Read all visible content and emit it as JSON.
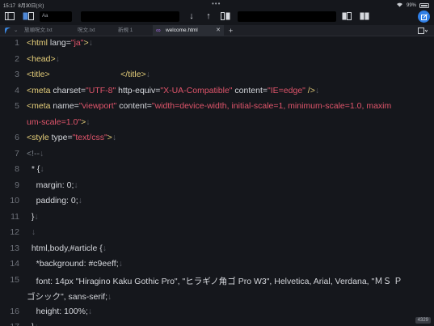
{
  "status": {
    "time": "15:17",
    "date": "8月30日(火)",
    "battery_percent": "99%"
  },
  "toolbar": {
    "box1_label": "Aa",
    "box2_label": "",
    "box3_label": "",
    "icons": [
      "sidebar-icon",
      "split-icon",
      "undo-icon",
      "redo-icon",
      "arrow-down-icon",
      "arrow-up-icon",
      "replace-icon",
      "compose-icon"
    ]
  },
  "tabs": [
    {
      "label": "旅順呪文.txt"
    },
    {
      "label": "呪文.txt"
    },
    {
      "label": "新規 1"
    },
    {
      "label": "welcome.html",
      "active": true
    }
  ],
  "editor": {
    "lines": [
      {
        "n": "1",
        "parts": [
          [
            "tag",
            "<html "
          ],
          [
            "attr",
            "lang="
          ],
          [
            "val",
            "\"ja\""
          ],
          [
            "tag",
            ">"
          ],
          [
            "ret",
            "↓"
          ]
        ]
      },
      {
        "n": "2",
        "parts": [
          [
            "tag",
            "<head>"
          ],
          [
            "ret",
            "↓"
          ]
        ]
      },
      {
        "n": "3",
        "parts": [
          [
            "tag",
            "<title>"
          ],
          [
            "txt",
            "                              "
          ],
          [
            "tag",
            "</title>"
          ],
          [
            "ret",
            "↓"
          ]
        ]
      },
      {
        "n": "4",
        "parts": [
          [
            "tag",
            "<meta "
          ],
          [
            "attr",
            "charset="
          ],
          [
            "val",
            "\"UTF-8\""
          ],
          [
            "attr",
            " http-equiv="
          ],
          [
            "val",
            "\"X-UA-Compatible\""
          ],
          [
            "attr",
            " content="
          ],
          [
            "val",
            "\"IE=edge\""
          ],
          [
            "tag",
            " />"
          ],
          [
            "ret",
            "↓"
          ]
        ]
      },
      {
        "n": "5",
        "parts": [
          [
            "tag",
            "<meta "
          ],
          [
            "attr",
            "name="
          ],
          [
            "val",
            "\"viewport\""
          ],
          [
            "attr",
            " content="
          ],
          [
            "val",
            "\"width=device-width, initial-scale=1, minimum-scale=1.0, maxim"
          ]
        ]
      },
      {
        "n": "",
        "parts": [
          [
            "val",
            "um-scale=1.0\""
          ],
          [
            "tag",
            ">"
          ],
          [
            "ret",
            "↓"
          ]
        ]
      },
      {
        "n": "6",
        "parts": [
          [
            "tag",
            "<style "
          ],
          [
            "attr",
            "type="
          ],
          [
            "val",
            "\"text/css\""
          ],
          [
            "tag",
            ">"
          ],
          [
            "ret",
            "↓"
          ]
        ]
      },
      {
        "n": "7",
        "parts": [
          [
            "cmt",
            "<!--"
          ],
          [
            "ret",
            "↓"
          ]
        ]
      },
      {
        "n": "8",
        "parts": [
          [
            "txt",
            "  * {"
          ],
          [
            "ret",
            "↓"
          ]
        ]
      },
      {
        "n": "9",
        "parts": [
          [
            "txt",
            "    margin: 0;"
          ],
          [
            "ret",
            "↓"
          ]
        ]
      },
      {
        "n": "10",
        "parts": [
          [
            "txt",
            "    padding: 0;"
          ],
          [
            "ret",
            "↓"
          ]
        ]
      },
      {
        "n": "11",
        "parts": [
          [
            "txt",
            "  }"
          ],
          [
            "ret",
            "↓"
          ]
        ]
      },
      {
        "n": "12",
        "parts": [
          [
            "ret",
            "  ↓"
          ]
        ]
      },
      {
        "n": "13",
        "parts": [
          [
            "txt",
            "  html,body,#article {"
          ],
          [
            "ret",
            "↓"
          ]
        ]
      },
      {
        "n": "14",
        "parts": [
          [
            "txt",
            "    *background: #c9eeff;"
          ],
          [
            "ret",
            "↓"
          ]
        ]
      },
      {
        "n": "15",
        "parts": [
          [
            "txt",
            "    font: 14px \"Hiragino Kaku Gothic Pro\", \"ヒラギノ角ゴ Pro W3\", Helvetica, Arial, Verdana, \"ＭＳ Ｐ"
          ]
        ]
      },
      {
        "n": "",
        "parts": [
          [
            "txt",
            "ゴシック\", sans-serif;"
          ],
          [
            "ret",
            "↓"
          ]
        ]
      },
      {
        "n": "16",
        "parts": [
          [
            "txt",
            "    height: 100%;"
          ],
          [
            "ret",
            "↓"
          ]
        ]
      },
      {
        "n": "17",
        "parts": [
          [
            "txt",
            "  }"
          ],
          [
            "ret",
            "↓"
          ]
        ]
      }
    ]
  },
  "bottom_badge": "4329"
}
